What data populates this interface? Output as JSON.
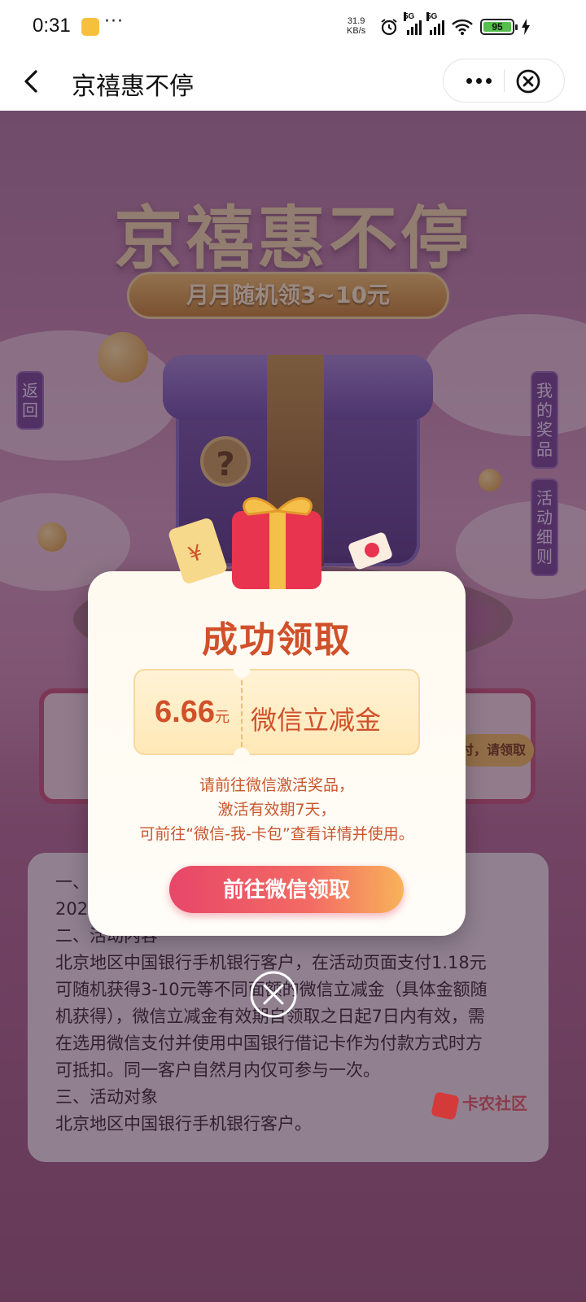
{
  "status_bar": {
    "time": "0:31",
    "dots": "···",
    "net_speed_value": "31.9",
    "net_speed_unit": "KB/s",
    "sim1": "5G",
    "sim2": "5G",
    "battery": "95"
  },
  "nav": {
    "title": "京禧惠不停"
  },
  "hero": {
    "title": "京禧惠不停",
    "subtitle": "月月随机领3~10元"
  },
  "side_buttons": {
    "back": "返回",
    "my_prizes": "我的奖品",
    "rules": "活动细则"
  },
  "background_card": {
    "partial_button": "付，请领取"
  },
  "rules": {
    "lines": [
      "一、",
      "2025年",
      "二、活动内容",
      "北京地区中国银行手机银行客户，在活动页面支付1.18元",
      "可随机获得3-10元等不同面额的微信立减金（具体金额随",
      "机获得），微信立减金有效期自领取之日起7日内有效，需",
      "在选用微信支付并使用中国银行借记卡作为付款方式时方",
      "可抵扣。同一客户自然月内仅可参与一次。",
      "三、活动对象",
      "北京地区中国银行手机银行客户。"
    ]
  },
  "watermark": "卡农社区",
  "modal": {
    "title": "成功领取",
    "amount": "6.66",
    "unit": "元",
    "prize_name": "微信立减金",
    "message_lines": [
      "请前往微信激活奖品，",
      "激活有效期7天，",
      "可前往“微信-我-卡包”查看详情并使用。"
    ],
    "button": "前往微信领取"
  },
  "colors": {
    "accent": "#d0502a",
    "button_start": "#e84668",
    "button_end": "#f8b35a"
  },
  "icons": [
    "back-chevron-icon",
    "more-icon",
    "close-circle-icon",
    "alarm-icon",
    "signal-icon",
    "wifi-icon",
    "battery-icon",
    "charging-icon",
    "gift-icon"
  ]
}
